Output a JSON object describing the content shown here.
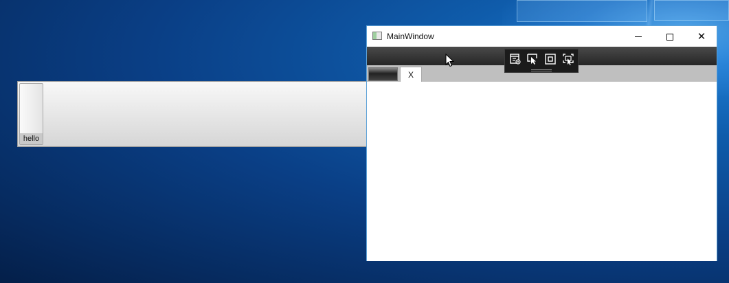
{
  "desktop": {
    "accent": "#0f5cab"
  },
  "floating_panel": {
    "item_label": "hello"
  },
  "window": {
    "title": "MainWindow",
    "minimize_icon": "minimize-icon",
    "maximize_icon": "maximize-icon",
    "close_icon": "close-icon",
    "close_glyph": "✕",
    "tabs": [
      {
        "label": ""
      },
      {
        "label": "X"
      }
    ]
  },
  "debug_toolbar": {
    "tools": [
      {
        "icon": "live-visual-tree-icon"
      },
      {
        "icon": "select-element-icon"
      },
      {
        "icon": "display-layout-adorners-icon"
      },
      {
        "icon": "track-focused-element-icon"
      }
    ]
  }
}
